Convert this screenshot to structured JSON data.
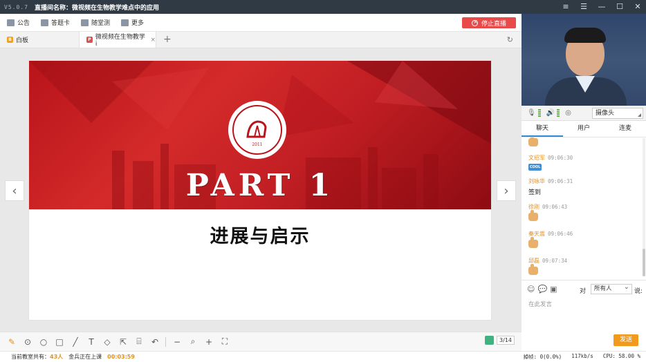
{
  "app": {
    "version": "V5.0.7",
    "title": "直播间名称：微视频在生物教学难点中的应用"
  },
  "toolbar": {
    "items": [
      {
        "label": "公告",
        "icon": "megaphone-icon"
      },
      {
        "label": "答题卡",
        "icon": "answer-card-icon"
      },
      {
        "label": "随堂测",
        "icon": "quiz-icon"
      },
      {
        "label": "更多",
        "icon": "grid-icon"
      }
    ],
    "stop_label": "停止直播"
  },
  "tabs": {
    "whiteboard": {
      "label": "白板",
      "badge": "B"
    },
    "document": {
      "label": "微视频在生物教学i",
      "badge": "P"
    }
  },
  "slide": {
    "logo_year": "2011",
    "part_title": "PART 1",
    "subtitle": "进展与启示",
    "banner_color": "#c21f24"
  },
  "pager": {
    "page": "3/14"
  },
  "status": {
    "class_label": "当前教室共有：",
    "class_count": "43人",
    "teaching": "金兵正在上课",
    "duration": "00:03:59",
    "frame_loss": "掉帧: 0(0.0%)",
    "speed": "117kb/s",
    "cpu": "CPU: 58.00 %"
  },
  "media": {
    "camera_label": "摄像头"
  },
  "chat": {
    "tabs": [
      "聊天",
      "用户",
      "连麦"
    ],
    "messages": [
      {
        "name": "文绍军",
        "time": "09:06:30",
        "type": "cool"
      },
      {
        "name": "刘咏华",
        "time": "09:06:31",
        "type": "text",
        "text": "签到"
      },
      {
        "name": "徐刚",
        "time": "09:06:43",
        "type": "thumb"
      },
      {
        "name": "秦天嵩",
        "time": "09:06:46",
        "type": "thumb"
      },
      {
        "name": "邱磊",
        "time": "09:07:34",
        "type": "thumb"
      }
    ],
    "cool_label": "COOL",
    "to_label": "对",
    "to_value": "所有人",
    "say_label": "说:",
    "placeholder": "在此发言",
    "send_label": "发送"
  },
  "colors": {
    "accent": "#e8901a",
    "stop": "#e84a4a",
    "titlebar": "#2f3a45"
  }
}
